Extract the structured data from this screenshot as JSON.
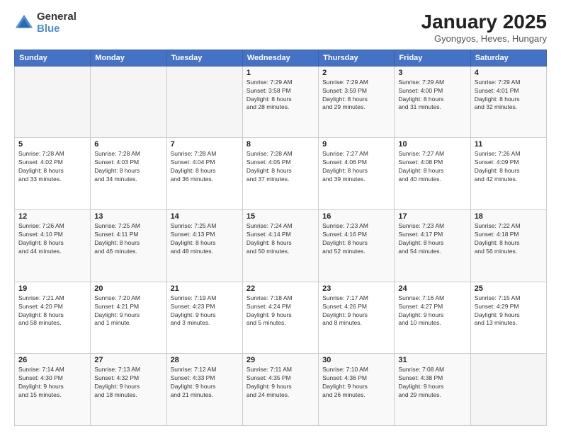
{
  "logo": {
    "general": "General",
    "blue": "Blue"
  },
  "title": "January 2025",
  "subtitle": "Gyongyos, Heves, Hungary",
  "days_of_week": [
    "Sunday",
    "Monday",
    "Tuesday",
    "Wednesday",
    "Thursday",
    "Friday",
    "Saturday"
  ],
  "weeks": [
    [
      {
        "day": "",
        "info": ""
      },
      {
        "day": "",
        "info": ""
      },
      {
        "day": "",
        "info": ""
      },
      {
        "day": "1",
        "info": "Sunrise: 7:29 AM\nSunset: 3:58 PM\nDaylight: 8 hours\nand 28 minutes."
      },
      {
        "day": "2",
        "info": "Sunrise: 7:29 AM\nSunset: 3:59 PM\nDaylight: 8 hours\nand 29 minutes."
      },
      {
        "day": "3",
        "info": "Sunrise: 7:29 AM\nSunset: 4:00 PM\nDaylight: 8 hours\nand 31 minutes."
      },
      {
        "day": "4",
        "info": "Sunrise: 7:29 AM\nSunset: 4:01 PM\nDaylight: 8 hours\nand 32 minutes."
      }
    ],
    [
      {
        "day": "5",
        "info": "Sunrise: 7:28 AM\nSunset: 4:02 PM\nDaylight: 8 hours\nand 33 minutes."
      },
      {
        "day": "6",
        "info": "Sunrise: 7:28 AM\nSunset: 4:03 PM\nDaylight: 8 hours\nand 34 minutes."
      },
      {
        "day": "7",
        "info": "Sunrise: 7:28 AM\nSunset: 4:04 PM\nDaylight: 8 hours\nand 36 minutes."
      },
      {
        "day": "8",
        "info": "Sunrise: 7:28 AM\nSunset: 4:05 PM\nDaylight: 8 hours\nand 37 minutes."
      },
      {
        "day": "9",
        "info": "Sunrise: 7:27 AM\nSunset: 4:06 PM\nDaylight: 8 hours\nand 39 minutes."
      },
      {
        "day": "10",
        "info": "Sunrise: 7:27 AM\nSunset: 4:08 PM\nDaylight: 8 hours\nand 40 minutes."
      },
      {
        "day": "11",
        "info": "Sunrise: 7:26 AM\nSunset: 4:09 PM\nDaylight: 8 hours\nand 42 minutes."
      }
    ],
    [
      {
        "day": "12",
        "info": "Sunrise: 7:26 AM\nSunset: 4:10 PM\nDaylight: 8 hours\nand 44 minutes."
      },
      {
        "day": "13",
        "info": "Sunrise: 7:25 AM\nSunset: 4:11 PM\nDaylight: 8 hours\nand 46 minutes."
      },
      {
        "day": "14",
        "info": "Sunrise: 7:25 AM\nSunset: 4:13 PM\nDaylight: 8 hours\nand 48 minutes."
      },
      {
        "day": "15",
        "info": "Sunrise: 7:24 AM\nSunset: 4:14 PM\nDaylight: 8 hours\nand 50 minutes."
      },
      {
        "day": "16",
        "info": "Sunrise: 7:23 AM\nSunset: 4:16 PM\nDaylight: 8 hours\nand 52 minutes."
      },
      {
        "day": "17",
        "info": "Sunrise: 7:23 AM\nSunset: 4:17 PM\nDaylight: 8 hours\nand 54 minutes."
      },
      {
        "day": "18",
        "info": "Sunrise: 7:22 AM\nSunset: 4:18 PM\nDaylight: 8 hours\nand 56 minutes."
      }
    ],
    [
      {
        "day": "19",
        "info": "Sunrise: 7:21 AM\nSunset: 4:20 PM\nDaylight: 8 hours\nand 58 minutes."
      },
      {
        "day": "20",
        "info": "Sunrise: 7:20 AM\nSunset: 4:21 PM\nDaylight: 9 hours\nand 1 minute."
      },
      {
        "day": "21",
        "info": "Sunrise: 7:19 AM\nSunset: 4:23 PM\nDaylight: 9 hours\nand 3 minutes."
      },
      {
        "day": "22",
        "info": "Sunrise: 7:18 AM\nSunset: 4:24 PM\nDaylight: 9 hours\nand 5 minutes."
      },
      {
        "day": "23",
        "info": "Sunrise: 7:17 AM\nSunset: 4:26 PM\nDaylight: 9 hours\nand 8 minutes."
      },
      {
        "day": "24",
        "info": "Sunrise: 7:16 AM\nSunset: 4:27 PM\nDaylight: 9 hours\nand 10 minutes."
      },
      {
        "day": "25",
        "info": "Sunrise: 7:15 AM\nSunset: 4:29 PM\nDaylight: 9 hours\nand 13 minutes."
      }
    ],
    [
      {
        "day": "26",
        "info": "Sunrise: 7:14 AM\nSunset: 4:30 PM\nDaylight: 9 hours\nand 15 minutes."
      },
      {
        "day": "27",
        "info": "Sunrise: 7:13 AM\nSunset: 4:32 PM\nDaylight: 9 hours\nand 18 minutes."
      },
      {
        "day": "28",
        "info": "Sunrise: 7:12 AM\nSunset: 4:33 PM\nDaylight: 9 hours\nand 21 minutes."
      },
      {
        "day": "29",
        "info": "Sunrise: 7:11 AM\nSunset: 4:35 PM\nDaylight: 9 hours\nand 24 minutes."
      },
      {
        "day": "30",
        "info": "Sunrise: 7:10 AM\nSunset: 4:36 PM\nDaylight: 9 hours\nand 26 minutes."
      },
      {
        "day": "31",
        "info": "Sunrise: 7:08 AM\nSunset: 4:38 PM\nDaylight: 9 hours\nand 29 minutes."
      },
      {
        "day": "",
        "info": ""
      }
    ]
  ]
}
